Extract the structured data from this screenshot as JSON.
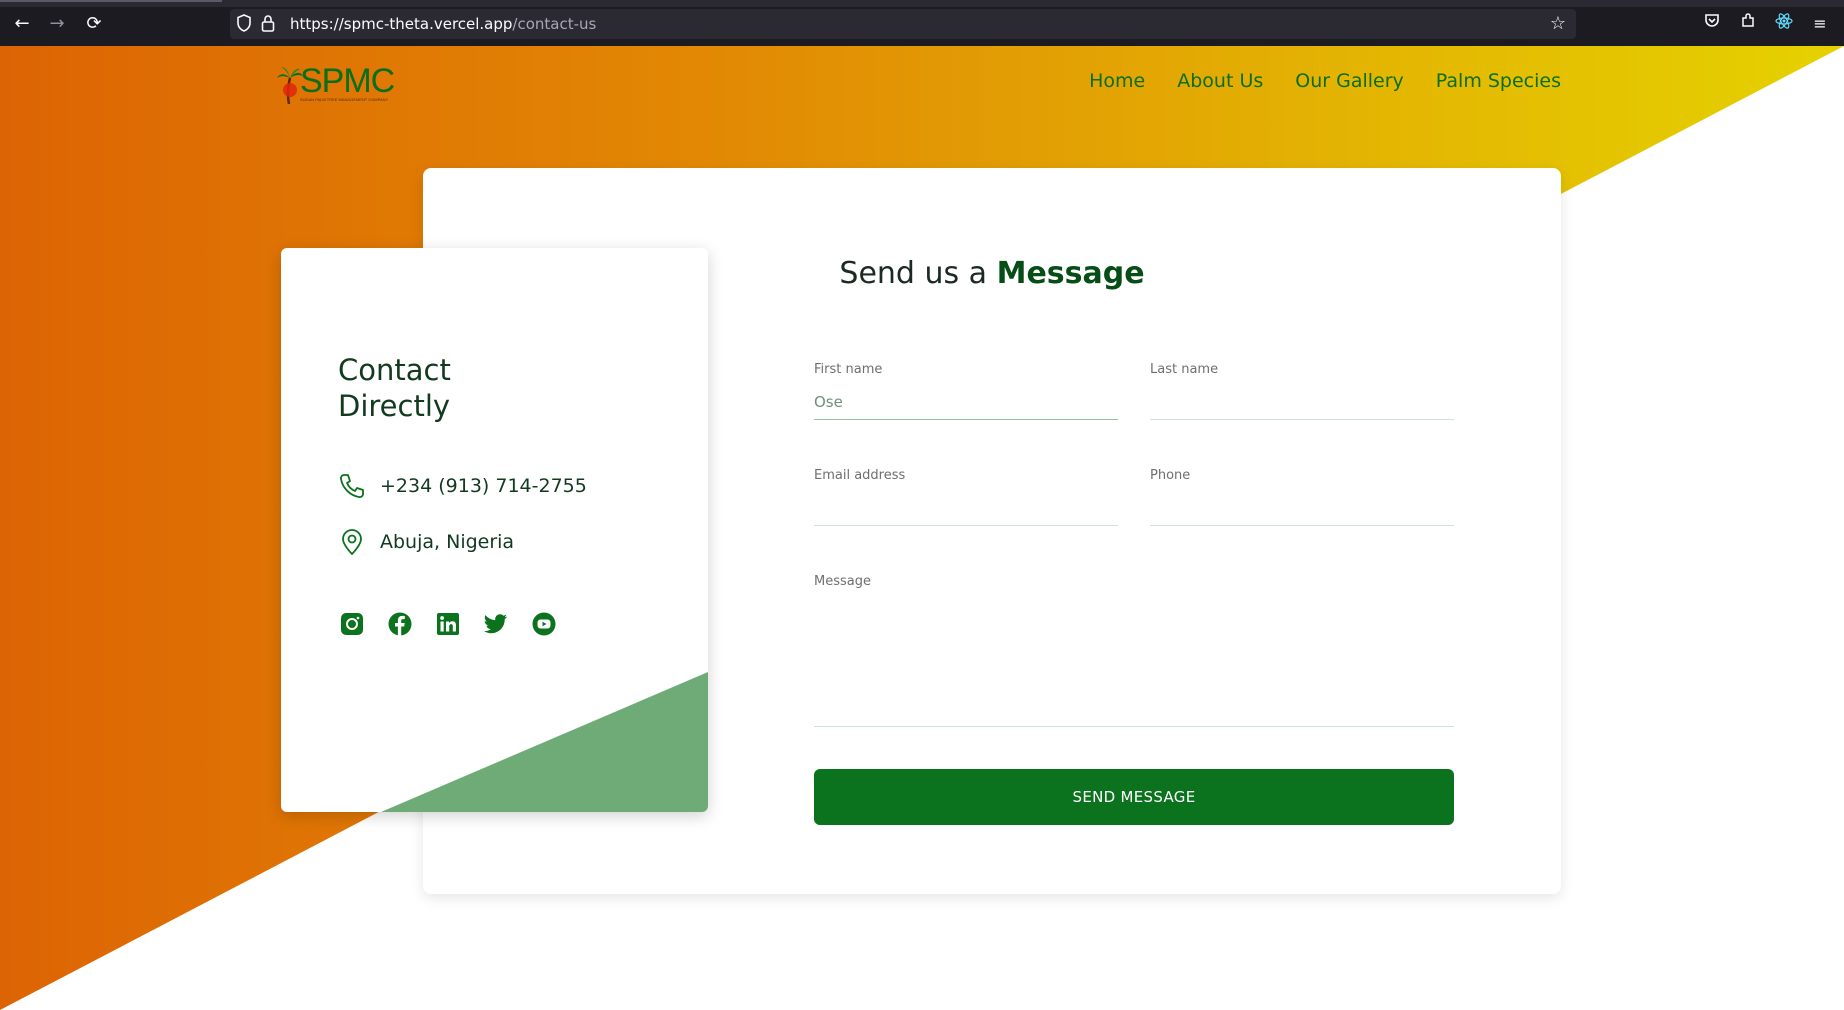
{
  "browser": {
    "url_domain": "https://spmc-theta.vercel.app",
    "url_path": "/contact-us",
    "back_icon": "back-arrow-icon",
    "forward_icon": "forward-arrow-icon",
    "reload_icon": "reload-icon"
  },
  "header": {
    "logo_text": "SPMC",
    "logo_subtext": "SUDAN PALM TREE MANAGEMENT COMPANY",
    "nav": [
      "Home",
      "About Us",
      "Our Gallery",
      "Palm Species"
    ]
  },
  "contact": {
    "title": "Contact Directly",
    "phone": "+234 (913) 714-2755",
    "location": "Abuja, Nigeria",
    "socials": [
      "instagram-icon",
      "facebook-icon",
      "linkedin-icon",
      "twitter-icon",
      "youtube-icon"
    ]
  },
  "form": {
    "title_prefix": "Send us a",
    "title_strong": "Message",
    "first_name_label": "First name",
    "first_name_value": "Ose",
    "last_name_label": "Last name",
    "last_name_value": "",
    "email_label": "Email address",
    "email_value": "",
    "phone_label": "Phone",
    "phone_value": "",
    "message_label": "Message",
    "message_value": "",
    "submit_label": "SEND MESSAGE"
  },
  "colors": {
    "brand_green": "#0b721d",
    "gradient_start": "#dd6404",
    "gradient_end": "#e5d200",
    "triangle_green": "#6fab76"
  }
}
